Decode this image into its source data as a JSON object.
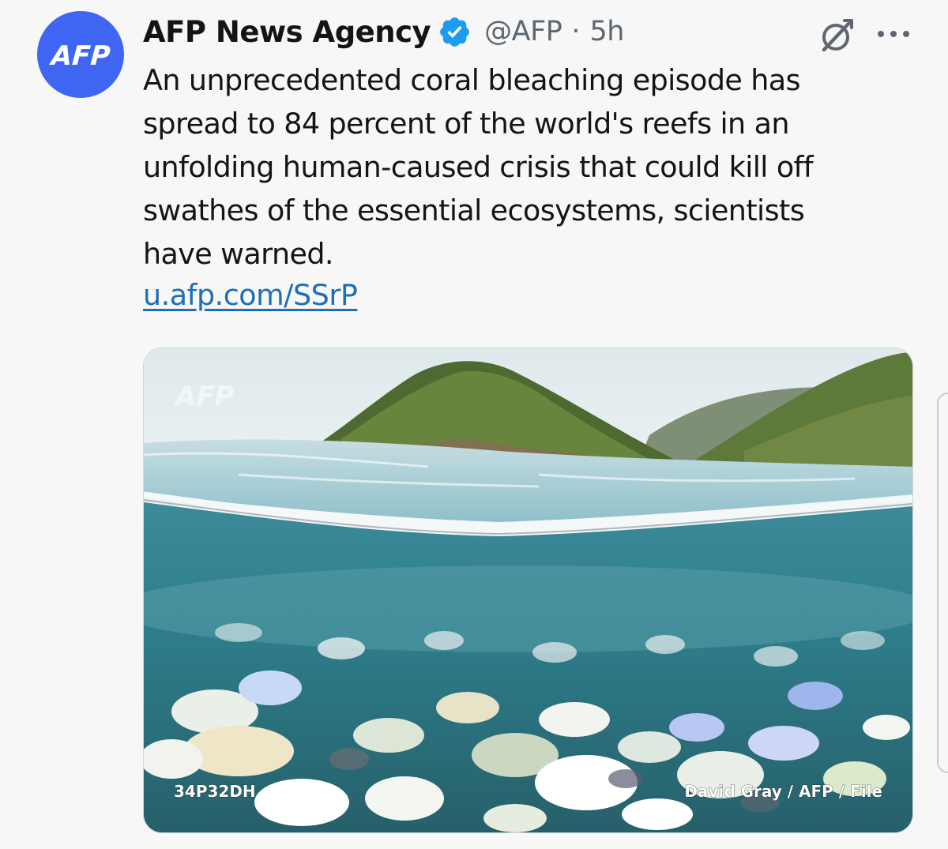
{
  "account": {
    "avatar_text": "AFP",
    "name": "AFP News Agency",
    "handle": "@AFP",
    "separator": "·",
    "time": "5h"
  },
  "colors": {
    "avatar_bg": "#3f66f2",
    "verified_badge": "#1d9bf0",
    "link": "#1d6fb8"
  },
  "icons": {
    "verified": "verified-badge-icon",
    "grok": "grok-icon",
    "more": "more-options-icon"
  },
  "tweet": {
    "lines": [
      "An unprecedented coral bleaching episode has",
      "spread to 84 percent of the world's reefs in an",
      "unfolding human-caused crisis that could kill off",
      "swathes of the essential ecosystems, scientists",
      "have warned."
    ],
    "link": "u.afp.com/SSrP"
  },
  "media": {
    "watermark": "AFP",
    "caption_left": "34P32DH",
    "caption_right": "David Gray / AFP / File"
  }
}
